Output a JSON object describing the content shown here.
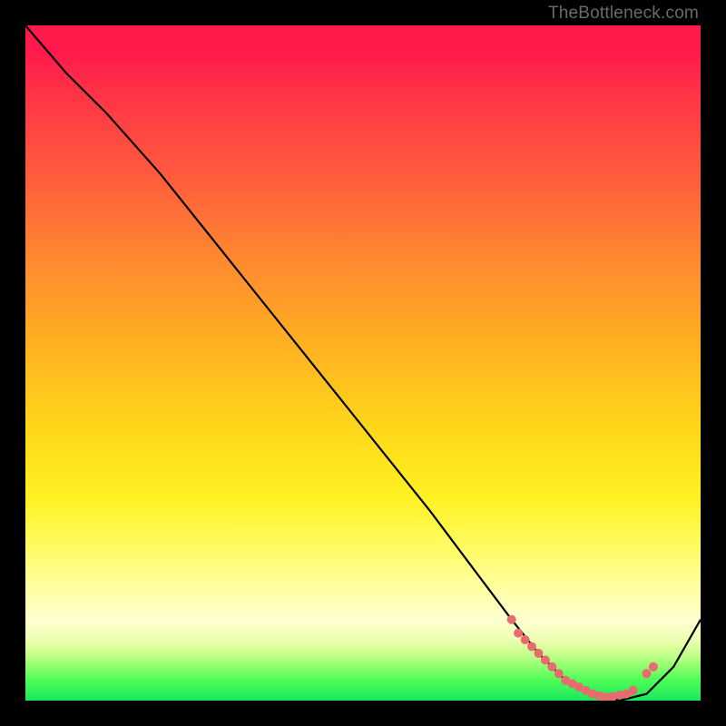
{
  "watermark": "TheBottleneck.com",
  "chart_data": {
    "type": "line",
    "title": "",
    "xlabel": "",
    "ylabel": "",
    "xlim": [
      0,
      100
    ],
    "ylim": [
      0,
      100
    ],
    "series": [
      {
        "name": "curve",
        "x": [
          0,
          6,
          12,
          20,
          28,
          36,
          44,
          52,
          60,
          66,
          72,
          76,
          80,
          84,
          88,
          92,
          96,
          100
        ],
        "y": [
          100,
          93,
          87,
          78,
          68,
          58,
          48,
          38,
          28,
          20,
          12,
          7,
          3,
          1,
          0,
          1,
          5,
          12
        ]
      }
    ],
    "markers": {
      "name": "highlight-dots",
      "color": "#e96a6f",
      "x": [
        72,
        73,
        74,
        75,
        76,
        77,
        78,
        79,
        80,
        81,
        82,
        83,
        84,
        85,
        86,
        87,
        88,
        89,
        90,
        92,
        93
      ],
      "y": [
        12,
        10,
        9,
        8,
        7,
        6,
        5,
        4,
        3,
        2.5,
        2,
        1.5,
        1,
        0.7,
        0.5,
        0.6,
        0.8,
        1,
        1.5,
        4,
        5
      ]
    }
  }
}
